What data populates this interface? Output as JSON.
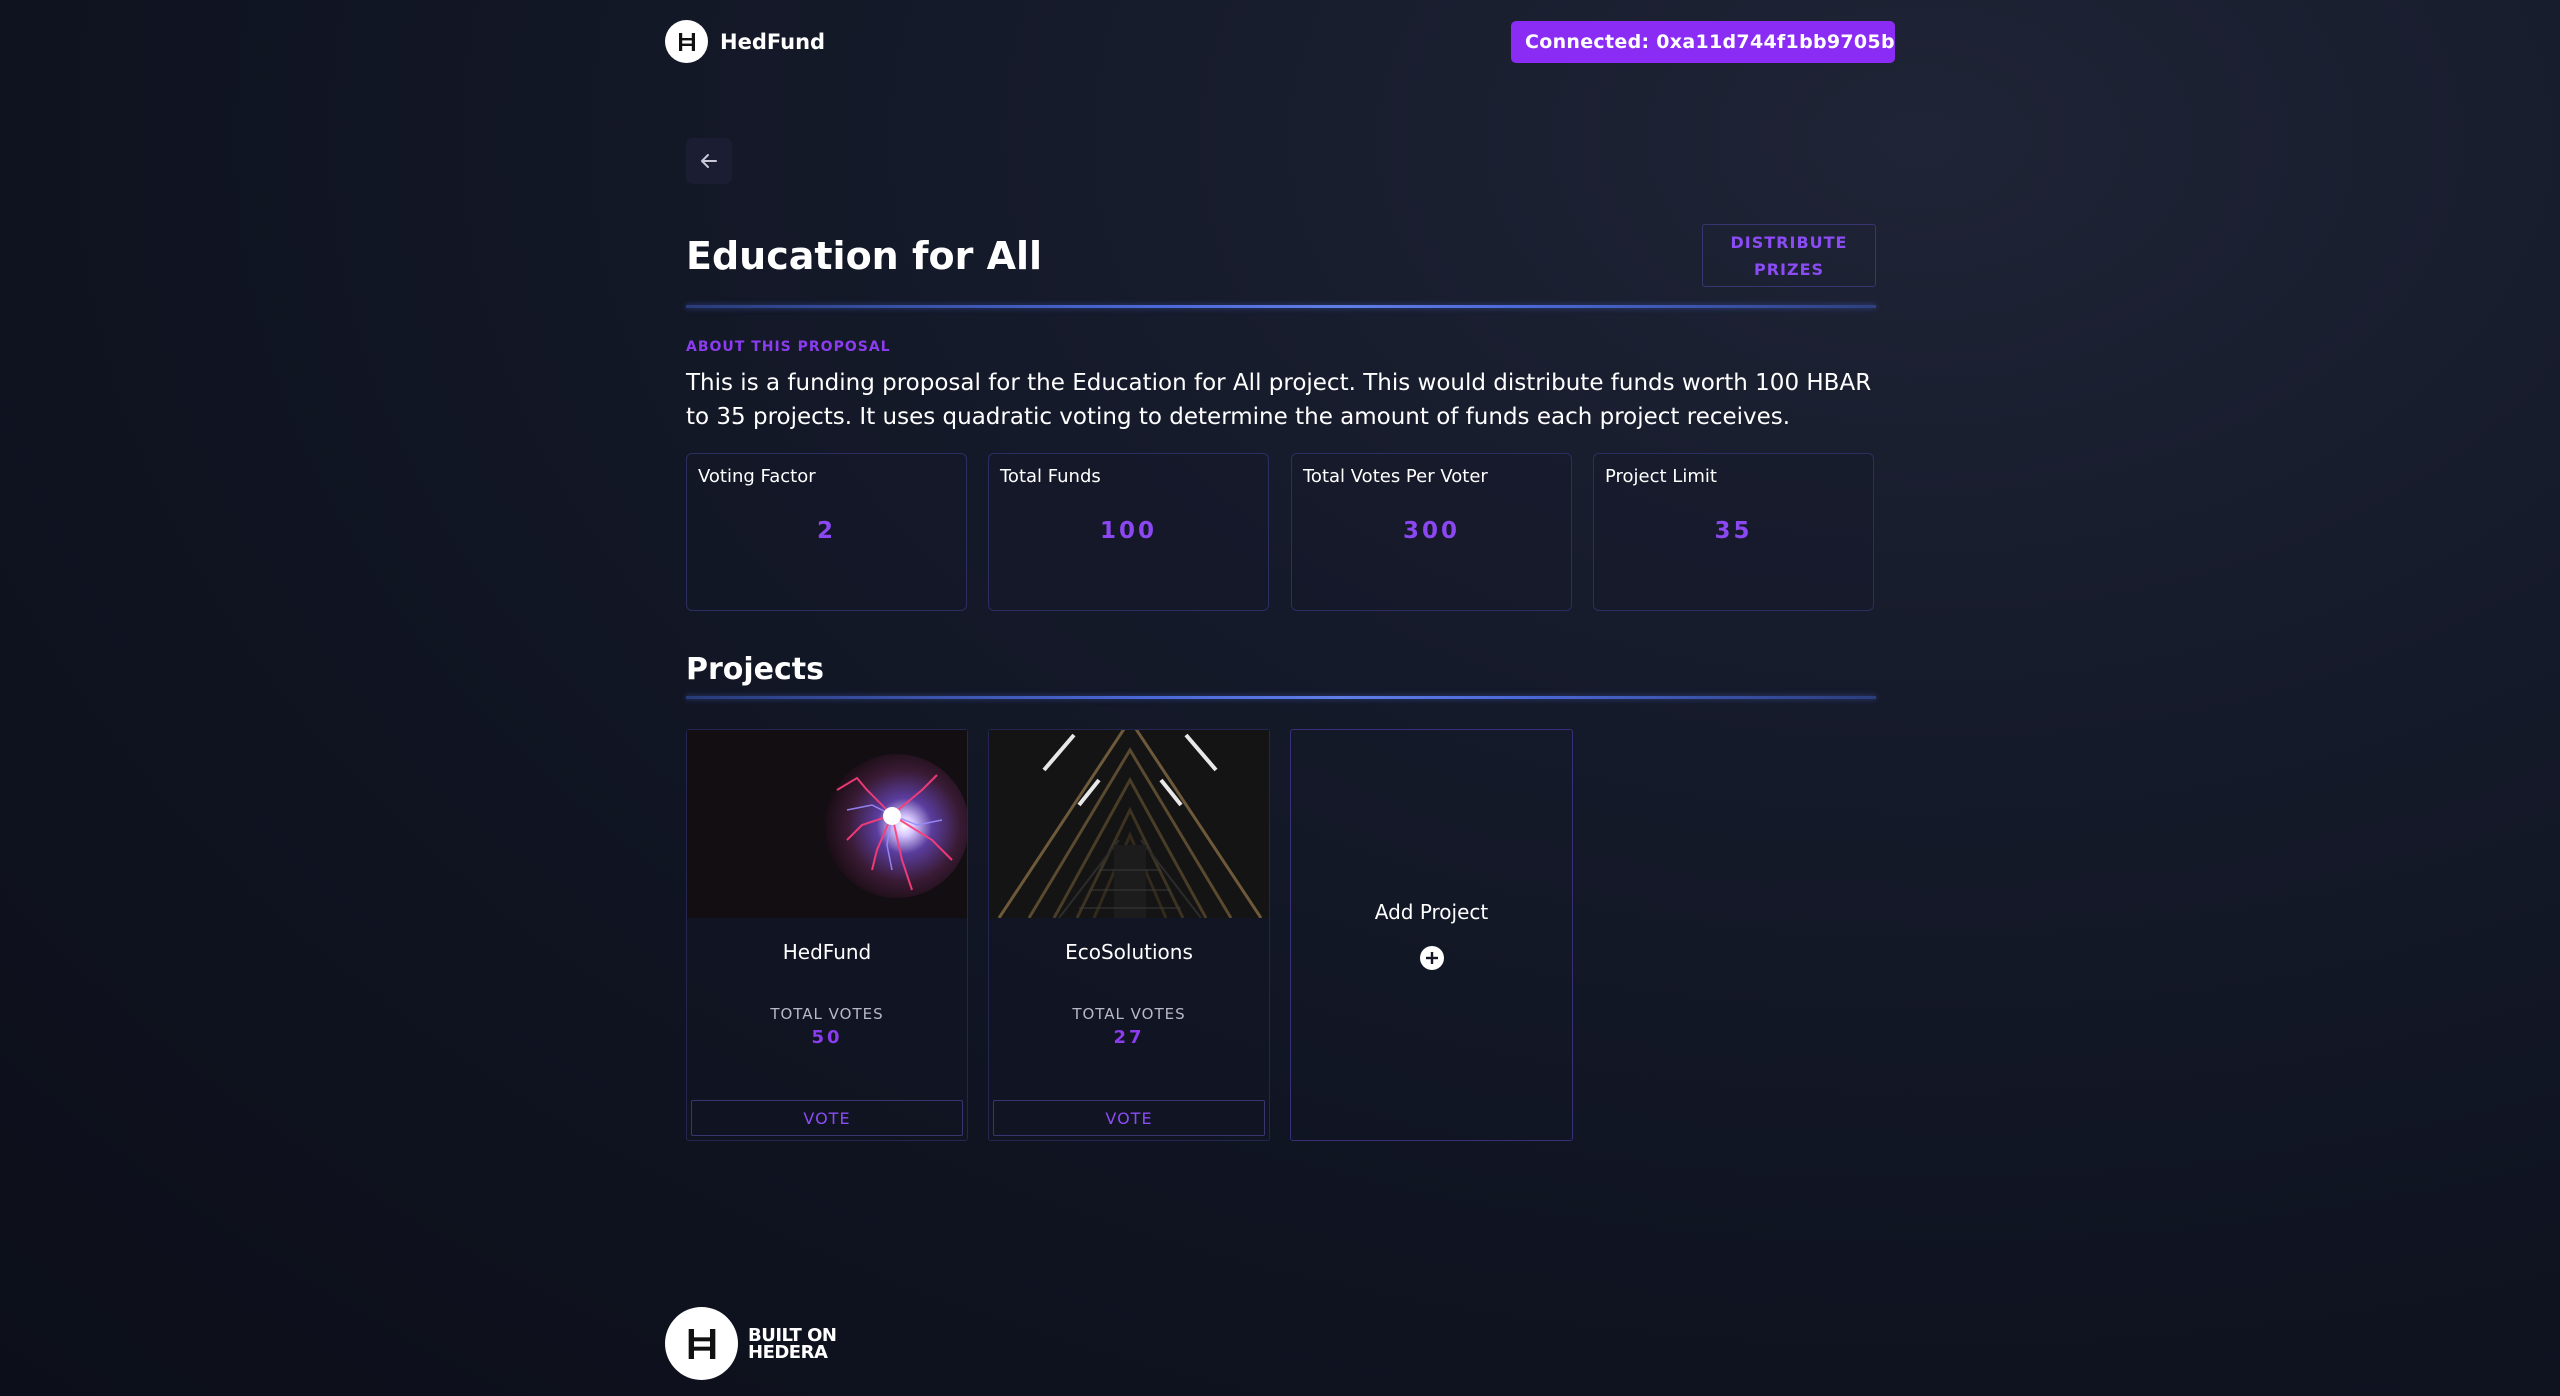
{
  "header": {
    "logo_name": "HedFund",
    "connect_label": "Connected: 0xa11d744f1bb9705b..."
  },
  "proposal": {
    "title": "Education for All",
    "distribute_line1": "DISTRIBUTE",
    "distribute_line2": "PRIZES",
    "about_label": "ABOUT THIS PROPOSAL",
    "description": "This is a funding proposal for the Education for All project. This would distribute funds worth 100 HBAR to 35 projects. It uses quadratic voting to determine the amount of funds each project receives."
  },
  "stats": [
    {
      "label": "Voting Factor",
      "value": "2"
    },
    {
      "label": "Total Funds",
      "value": "100"
    },
    {
      "label": "Total Votes Per Voter",
      "value": "300"
    },
    {
      "label": "Project Limit",
      "value": "35"
    }
  ],
  "projects_section": {
    "title": "Projects",
    "items": [
      {
        "name": "HedFund",
        "votes_label": "TOTAL VOTES",
        "votes": "50",
        "vote_label": "VOTE",
        "image": "plasma-ball-image"
      },
      {
        "name": "EcoSolutions",
        "votes_label": "TOTAL VOTES",
        "votes": "27",
        "vote_label": "VOTE",
        "image": "triangle-tunnel-image"
      }
    ],
    "add_label": "Add Project"
  },
  "footer": {
    "line1": "BUILT ON",
    "line2": "HEDERA"
  },
  "colors": {
    "accent": "#8b2cf5",
    "accent_text": "#8b48f2",
    "background": "#0f1320",
    "divider": "#4b6ad9"
  },
  "icons": {
    "logo": "hedera-h-icon",
    "back": "arrow-left-icon",
    "add": "plus-circle-icon"
  }
}
